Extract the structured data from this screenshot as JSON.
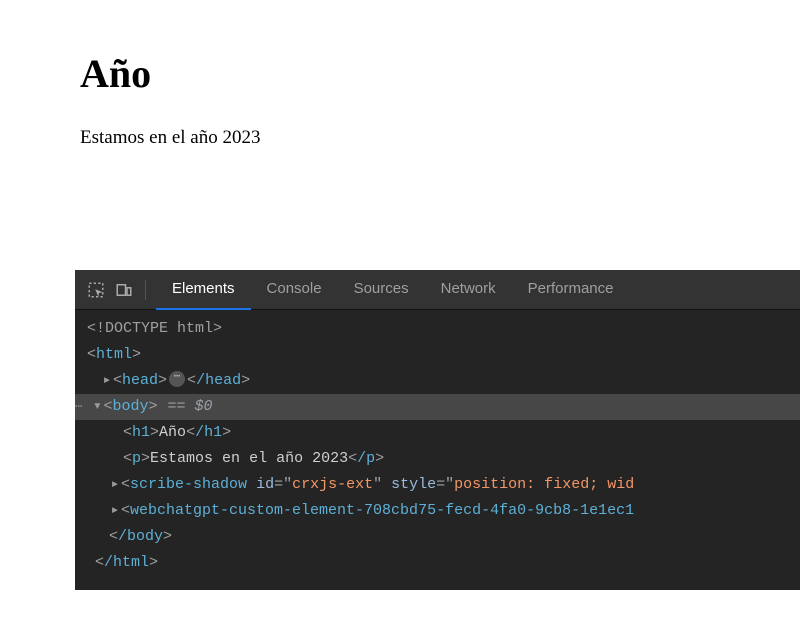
{
  "page": {
    "h1": "Año",
    "p": "Estamos en el año 2023"
  },
  "devtools": {
    "tabs": {
      "elements": "Elements",
      "console": "Console",
      "sources": "Sources",
      "network": "Network",
      "performance": "Performance"
    },
    "eq0": "== $0",
    "dom": {
      "doctype": "<!DOCTYPE html>",
      "html_open": "html",
      "head_open": "head",
      "head_close": "/head",
      "body_open": "body",
      "h1_open": "h1",
      "h1_text": "Año",
      "h1_close": "/h1",
      "p_open": "p",
      "p_text": "Estamos en el año 2023",
      "p_close": "/p",
      "scribe_tag": "scribe-shadow",
      "scribe_id_name": "id",
      "scribe_id_val": "crxjs-ext",
      "scribe_style_name": "style",
      "scribe_style_val": "position: fixed; wid",
      "webchat_tag": "webchatgpt-custom-element-708cbd75-fecd-4fa0-9cb8-1e1ec1",
      "body_close": "/body",
      "html_close": "/html"
    }
  }
}
